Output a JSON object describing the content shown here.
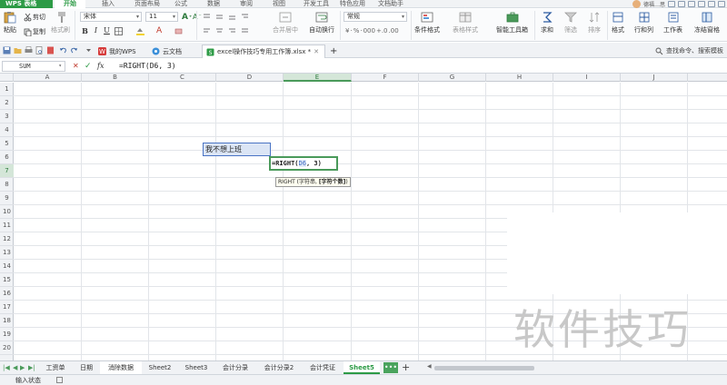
{
  "app": {
    "name": "WPS 表格"
  },
  "ribbon_tabs": [
    "开始",
    "插入",
    "页面布局",
    "公式",
    "数据",
    "审阅",
    "视图",
    "开发工具",
    "特色应用",
    "文档助手"
  ],
  "active_ribbon_tab": "开始",
  "user": {
    "name": "德福…思"
  },
  "ribbon": {
    "paste": "粘贴",
    "cut": "剪切",
    "copy": "复制",
    "format_painter": "格式刷",
    "font_name": "宋体",
    "font_size": "11",
    "bold": "B",
    "italic": "I",
    "underline": "U",
    "merge_center": "合并居中",
    "auto_wrap": "自动换行",
    "number_format": "常规",
    "conditional_format": "条件格式",
    "table_style": "表格样式",
    "smart_toolbox": "智能工具箱",
    "sum": "求和",
    "filter": "筛选",
    "sort": "排序",
    "format": "格式",
    "row_col": "行和列",
    "worksheet": "工作表",
    "freeze_pane": "冻结窗格"
  },
  "doc_tabs": [
    {
      "label": "我的WPS"
    },
    {
      "label": "云文档"
    },
    {
      "label": "excel操作技巧专用工作簿.xlsx *"
    }
  ],
  "add_tab": "+",
  "help_search": "查找命令、搜索模板",
  "formula_bar": {
    "name_box": "SUM",
    "cancel": "✕",
    "confirm": "✓",
    "fx": "fx",
    "formula": "=RIGHT(D6, 3)"
  },
  "columns": [
    "A",
    "B",
    "C",
    "D",
    "E",
    "F",
    "G",
    "H",
    "I",
    "J"
  ],
  "selected_column": "E",
  "rows": [
    "1",
    "2",
    "3",
    "4",
    "5",
    "6",
    "7",
    "8",
    "9",
    "10",
    "11",
    "12",
    "13",
    "14",
    "15",
    "16",
    "17",
    "18",
    "19",
    "20"
  ],
  "selected_row": "7",
  "cells": {
    "D6": "我不想上班",
    "E7_prefix": "=RIGHT(",
    "E7_ref": "D6",
    "E7_suffix": ", 3)"
  },
  "tooltip": {
    "func": "RIGHT (字符串, ",
    "bold_arg": "[字符个数]",
    "close": ")"
  },
  "sheets": [
    "工资单",
    "日期",
    "消除数据",
    "Sheet2",
    "Sheet3",
    "会计分录",
    "会计分录2",
    "会计凭证",
    "Sheet5"
  ],
  "active_sheet": "Sheet5",
  "more_sheets": "•••",
  "add_sheet": "+",
  "status": {
    "text": "输入状态"
  },
  "watermark": "软件技巧",
  "colors": {
    "accent": "#2d9b46",
    "selection": "#4a74c4"
  }
}
